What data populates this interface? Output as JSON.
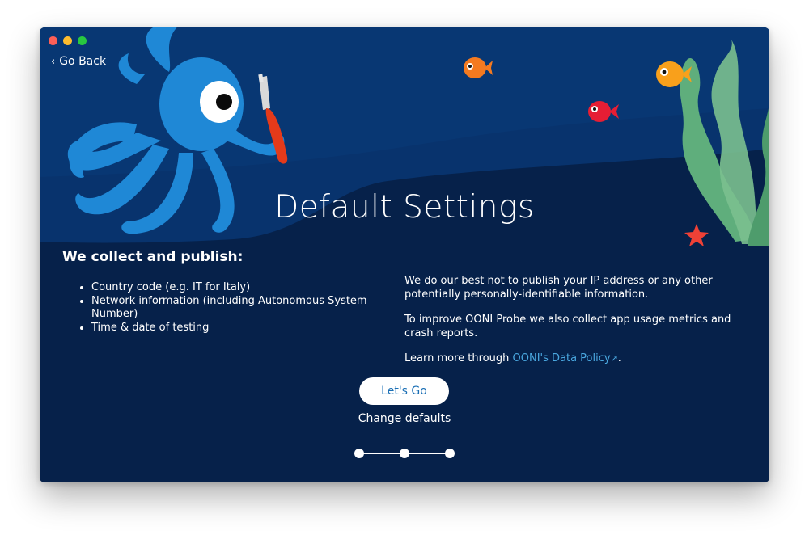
{
  "window": {
    "controls": [
      "close",
      "minimize",
      "maximize"
    ]
  },
  "nav": {
    "go_back_label": "Go Back",
    "go_back_icon": "chevron-left-icon"
  },
  "header": {
    "title": "Default Settings"
  },
  "collect": {
    "heading": "We collect and publish:",
    "items": [
      "Country code (e.g. IT for Italy)",
      "Network information (including Autonomous System Number)",
      "Time & date of testing"
    ]
  },
  "privacy": {
    "paragraph1": "We do our best not to publish your IP address or any other potentially personally-identifiable information.",
    "paragraph2": "To improve OONI Probe we also collect app usage metrics and crash reports.",
    "learn_prefix": "Learn more through ",
    "learn_link": "OONI's Data Policy",
    "learn_suffix": "."
  },
  "actions": {
    "primary_label": "Let's Go",
    "secondary_label": "Change defaults"
  },
  "stepper": {
    "steps": 3,
    "current": 3
  },
  "colors": {
    "background": "#06214a",
    "accent_blue": "#1a6fb5",
    "link": "#4aa8e0",
    "octopus": "#1f88d6"
  }
}
